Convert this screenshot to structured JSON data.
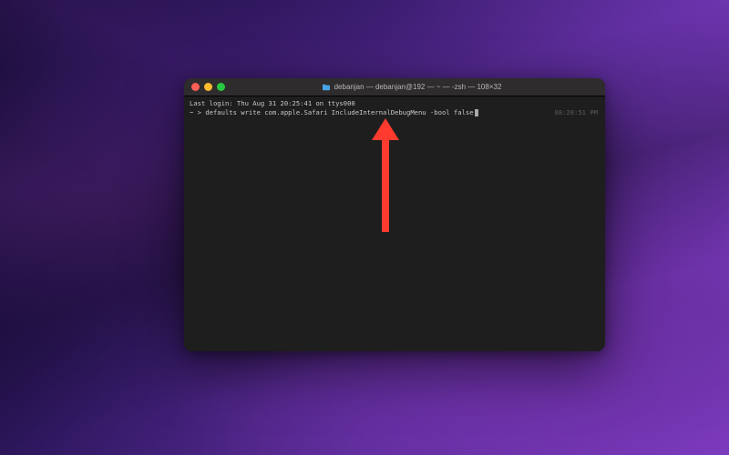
{
  "window": {
    "title": "debanjan — debanjan@192 — ~ — -zsh — 108×32",
    "traffic_light_close": "close",
    "traffic_light_minimize": "minimize",
    "traffic_light_maximize": "maximize"
  },
  "terminal": {
    "last_login": "Last login: Thu Aug 31 20:25:41 on ttys000",
    "prompt_prefix": "~ > ",
    "command": "defaults write com.apple.Safari IncludeInternalDebugMenu -bool false",
    "timestamp": "08:28:51 PM"
  },
  "annotation": {
    "arrow_color": "#ff3b2f"
  }
}
